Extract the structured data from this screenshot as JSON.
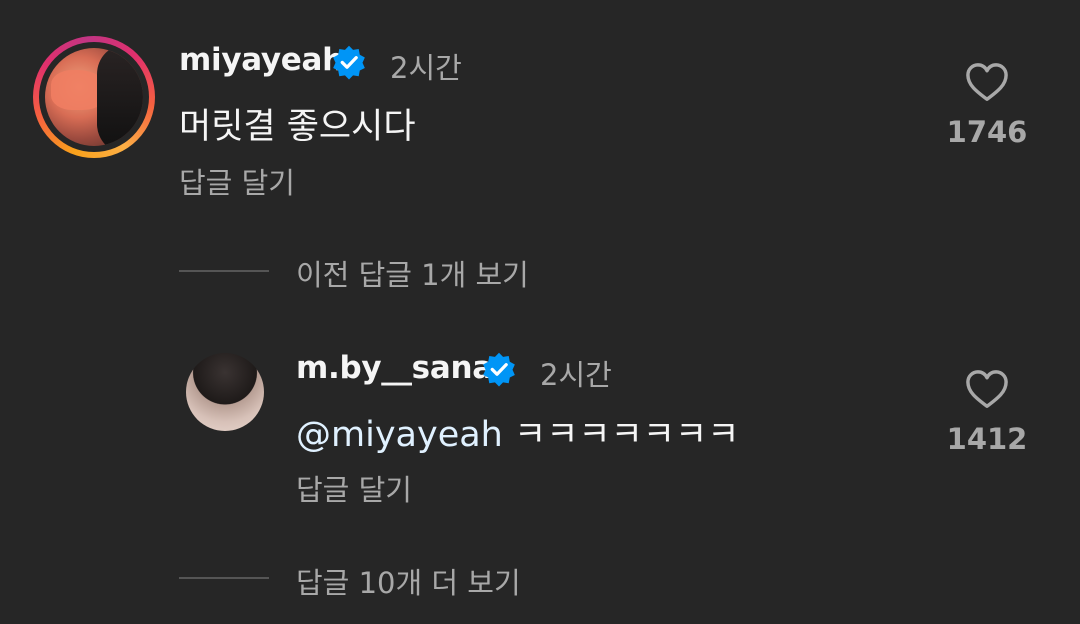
{
  "comment": {
    "username": "miyayeah",
    "time": "2시간",
    "text": "머릿결 좋으시다",
    "reply_label": "답글 달기",
    "like_count": "1746"
  },
  "previous_replies": {
    "text": "이전 답글 1개 보기"
  },
  "reply": {
    "username": "m.by__sana",
    "time": "2시간",
    "mention": "@miyayeah",
    "text": "ㅋㅋㅋㅋㅋㅋㅋ",
    "reply_label": "답글 달기",
    "like_count": "1412"
  },
  "more_replies": {
    "text": "답글 10개 더 보기"
  },
  "icons": {
    "verified": "verified-badge-icon",
    "like": "heart-icon"
  },
  "colors": {
    "background": "#262626",
    "primary_text": "#f5f5f5",
    "secondary_text": "#a8a8a8",
    "verified_blue": "#0095f6"
  }
}
